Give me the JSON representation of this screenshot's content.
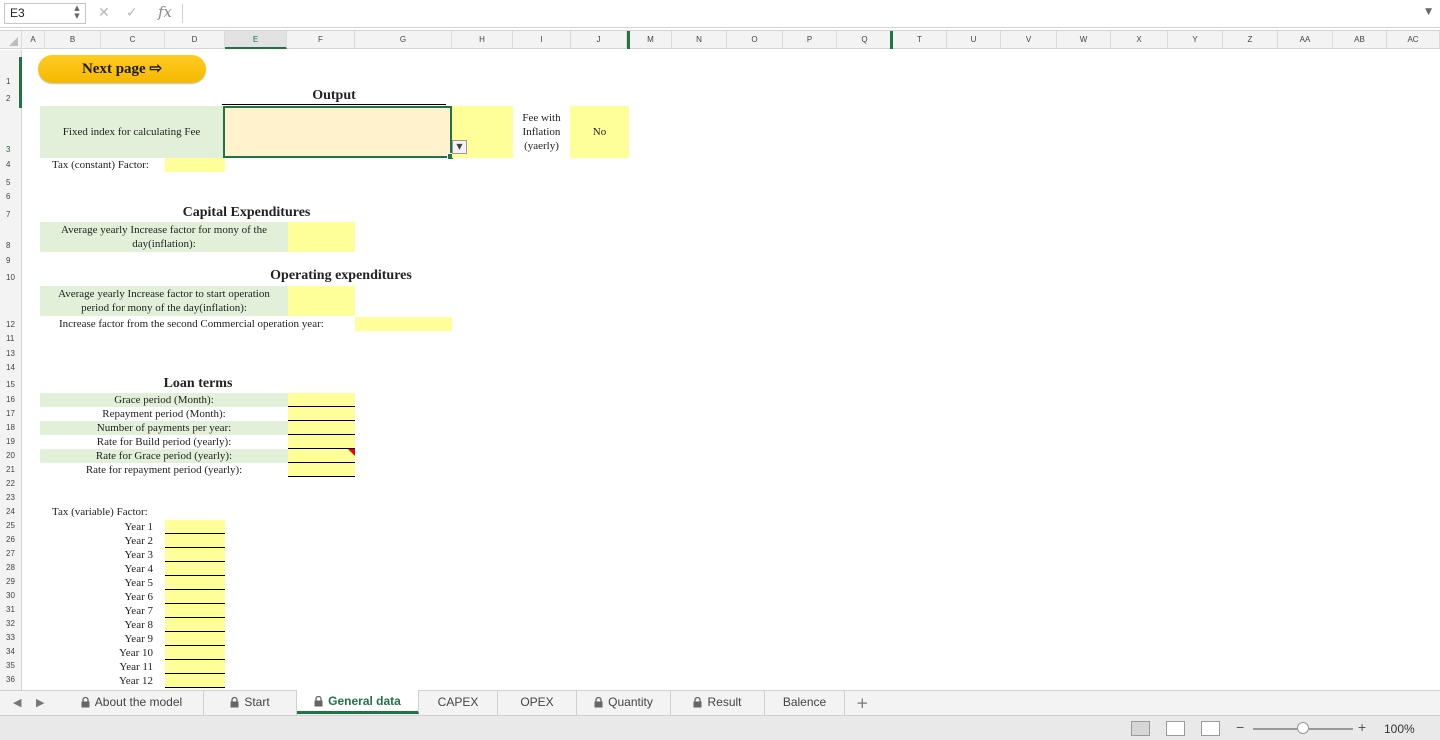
{
  "formula_bar": {
    "cell_ref": "E3",
    "fx_label": "fx",
    "cancel_glyph": "✕",
    "enter_glyph": "✓",
    "formula": ""
  },
  "columns": [
    "A",
    "B",
    "C",
    "D",
    "E",
    "F",
    "G",
    "H",
    "I",
    "J",
    "M",
    "N",
    "O",
    "P",
    "Q",
    "T",
    "U",
    "V",
    "W",
    "X",
    "Y",
    "Z",
    "AA",
    "AB",
    "AC"
  ],
  "rows": [
    "1",
    "2",
    "3",
    "4",
    "5",
    "6",
    "7",
    "8",
    "9",
    "10",
    "11",
    "12",
    "13",
    "14",
    "15",
    "16",
    "17",
    "18",
    "19",
    "20",
    "21",
    "22",
    "23",
    "24",
    "25",
    "26",
    "27",
    "28",
    "29",
    "30",
    "31",
    "32",
    "33",
    "34",
    "35",
    "36"
  ],
  "sheet": {
    "next_page": "Next page ⇨",
    "output_heading": "Output",
    "fixed_index_label": "Fixed index for calculating Fee",
    "fee_inflation_label": [
      "Fee with",
      "Inflation",
      "(yaerly)"
    ],
    "fee_inflation_value": "No",
    "tax_constant_label": "Tax (constant) Factor:",
    "capex_heading": "Capital Expenditures",
    "capex_avg_label": [
      "Average yearly Increase factor for mony of the",
      "day(inflation):"
    ],
    "opex_heading": "Operating expenditures",
    "opex_avg_label": [
      "Average yearly Increase factor to start operation",
      "period for mony of the day(inflation):"
    ],
    "opex_increase_label": "Increase factor from the second Commercial operation year:",
    "loan_heading": "Loan terms",
    "loan_items": [
      "Grace period (Month):",
      "Repayment period (Month):",
      "Number of payments per year:",
      "Rate for Build period (yearly):",
      "Rate for Grace period (yearly):",
      "Rate for repayment period (yearly):"
    ],
    "tax_variable_label": "Tax (variable) Factor:",
    "years": [
      "Year 1",
      "Year 2",
      "Year 3",
      "Year 4",
      "Year 5",
      "Year 6",
      "Year 7",
      "Year 8",
      "Year 9",
      "Year 10",
      "Year 11",
      "Year 12"
    ]
  },
  "tabs": [
    {
      "label": "About the model",
      "locked": true
    },
    {
      "label": "Start",
      "locked": true
    },
    {
      "label": "General data",
      "locked": true,
      "active": true
    },
    {
      "label": "CAPEX",
      "locked": false
    },
    {
      "label": "OPEX",
      "locked": false
    },
    {
      "label": "Quantity",
      "locked": true
    },
    {
      "label": "Result",
      "locked": true
    },
    {
      "label": "Balence",
      "locked": false
    }
  ],
  "add_sheet": "+",
  "status": {
    "zoom": "100%",
    "minus": "−",
    "plus": "+"
  },
  "colors": {
    "accent": "#217346",
    "input_yellow": "#ffff99",
    "label_green": "#e2f0d9",
    "button": "#f5b800"
  }
}
